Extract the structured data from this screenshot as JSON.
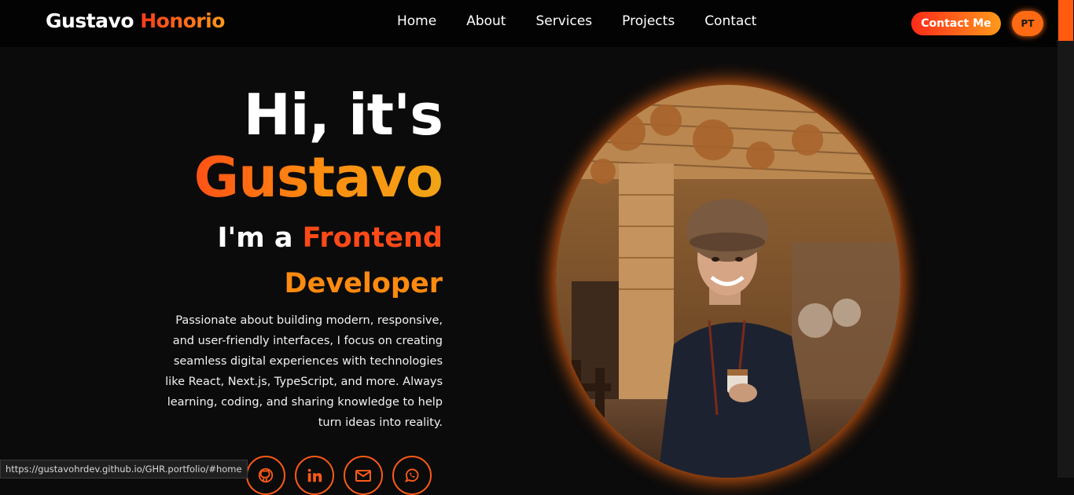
{
  "navbar": {
    "logo_first": "Gustavo",
    "logo_last": "Honorio",
    "links": [
      "Home",
      "About",
      "Services",
      "Projects",
      "Contact"
    ],
    "contact_button": "Contact Me",
    "language_button": "PT"
  },
  "hero": {
    "greeting": "Hi, it's",
    "name": "Gustavo",
    "role_prefix": "I'm a",
    "role_highlight": "Frontend",
    "role_highlight2": "Developer",
    "description": "Passionate about building modern, responsive, and user-friendly interfaces, I focus on creating seamless digital experiences with technologies like React, Next.js, TypeScript, and more. Always learning, coding, and sharing knowledge to help turn ideas into reality."
  },
  "socials": [
    "github-icon",
    "linkedin-icon",
    "mail-icon",
    "whatsapp-icon"
  ],
  "status_bar": {
    "url": "https://gustavohrdev.github.io/GHR.portfolio/#home"
  },
  "colors": {
    "accent": "#ff5a1f",
    "accent_gradient_start": "#ff2a1a",
    "accent_gradient_end": "#ff9a1a",
    "background": "#0b0b0b"
  }
}
